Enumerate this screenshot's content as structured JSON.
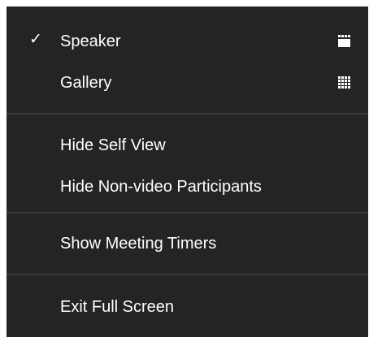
{
  "menu": {
    "items": [
      {
        "label": "Speaker",
        "checked": true,
        "icon": "speaker-view-icon"
      },
      {
        "label": "Gallery",
        "checked": false,
        "icon": "gallery-view-icon"
      },
      {
        "label": "Hide Self View"
      },
      {
        "label": "Hide Non-video Participants"
      },
      {
        "label": "Show Meeting Timers"
      },
      {
        "label": "Exit Full Screen"
      }
    ],
    "check_glyph": "✓"
  },
  "colors": {
    "background": "#242424",
    "text": "#ffffff",
    "divider": "#3a3a3a"
  }
}
